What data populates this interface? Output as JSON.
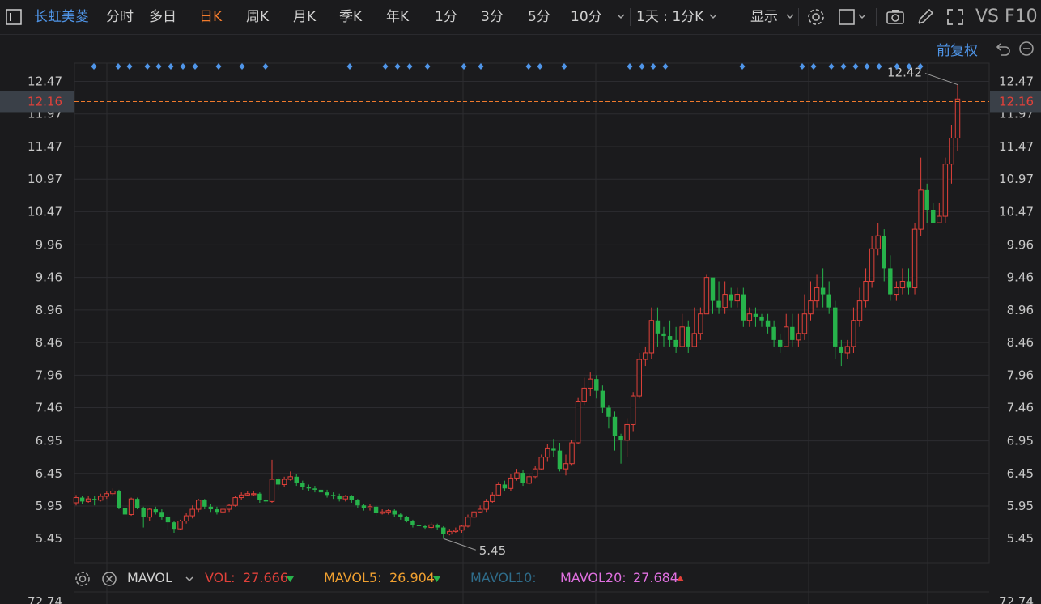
{
  "toolbar": {
    "stock_name": "长虹美菱",
    "periods": [
      "分时",
      "多日",
      "日K",
      "周K",
      "月K",
      "季K",
      "年K",
      "1分",
      "3分",
      "5分",
      "10分"
    ],
    "active_period": "日K",
    "interval_select": "1天 : 1分K",
    "display_label": "显示",
    "right_text": "VS F10"
  },
  "adjust_label": "前复权",
  "colors": {
    "up": "#e0413a",
    "down": "#27b34b",
    "accent": "#f07a2c",
    "link": "#4f95e8",
    "mavol5": "#f0a030",
    "mavol10": "#2f6c8a",
    "mavol20": "#e070e0",
    "grid": "#2c2c30"
  },
  "chart_data": {
    "type": "candlestick",
    "y_axis_ticks": [
      "12.47",
      "11.97",
      "11.47",
      "10.97",
      "10.47",
      "9.96",
      "9.46",
      "8.96",
      "8.46",
      "7.96",
      "7.46",
      "6.95",
      "6.45",
      "5.95",
      "5.45"
    ],
    "ylim": [
      5.08,
      12.75
    ],
    "current_price": "12.16",
    "max_label": "12.42",
    "min_label": "5.45",
    "bottom_axis_label": "72.74",
    "candles": [
      [
        6.0,
        6.08,
        6.12,
        5.96
      ],
      [
        6.08,
        6.02,
        6.1,
        5.98
      ],
      [
        6.02,
        6.06,
        6.1,
        6.0
      ],
      [
        6.06,
        6.04,
        6.1,
        5.96
      ],
      [
        6.04,
        6.1,
        6.14,
        6.02
      ],
      [
        6.1,
        6.14,
        6.18,
        6.06
      ],
      [
        6.14,
        6.18,
        6.22,
        6.1
      ],
      [
        6.18,
        5.92,
        6.2,
        5.9
      ],
      [
        5.92,
        5.82,
        5.96,
        5.8
      ],
      [
        5.82,
        6.06,
        6.08,
        5.8
      ],
      [
        6.06,
        5.92,
        6.08,
        5.9
      ],
      [
        5.92,
        5.78,
        5.94,
        5.62
      ],
      [
        5.78,
        5.9,
        5.92,
        5.72
      ],
      [
        5.9,
        5.86,
        5.94,
        5.82
      ],
      [
        5.86,
        5.78,
        5.9,
        5.74
      ],
      [
        5.78,
        5.7,
        5.82,
        5.58
      ],
      [
        5.7,
        5.6,
        5.72,
        5.54
      ],
      [
        5.6,
        5.72,
        5.74,
        5.58
      ],
      [
        5.72,
        5.8,
        5.84,
        5.68
      ],
      [
        5.8,
        5.9,
        5.96,
        5.76
      ],
      [
        5.9,
        6.04,
        6.06,
        5.86
      ],
      [
        6.04,
        5.94,
        6.06,
        5.9
      ],
      [
        5.94,
        5.9,
        5.98,
        5.86
      ],
      [
        5.9,
        5.86,
        5.94,
        5.82
      ],
      [
        5.86,
        5.9,
        5.92,
        5.82
      ],
      [
        5.9,
        5.96,
        5.98,
        5.86
      ],
      [
        5.96,
        6.08,
        6.1,
        5.94
      ],
      [
        6.08,
        6.12,
        6.16,
        6.04
      ],
      [
        6.12,
        6.14,
        6.18,
        6.1
      ],
      [
        6.14,
        6.14,
        6.18,
        6.1
      ],
      [
        6.14,
        6.04,
        6.16,
        6.0
      ],
      [
        6.04,
        6.02,
        6.06,
        5.98
      ],
      [
        6.02,
        6.36,
        6.66,
        6.0
      ],
      [
        6.36,
        6.28,
        6.4,
        6.2
      ],
      [
        6.28,
        6.36,
        6.4,
        6.24
      ],
      [
        6.36,
        6.4,
        6.48,
        6.34
      ],
      [
        6.4,
        6.3,
        6.44,
        6.26
      ],
      [
        6.3,
        6.24,
        6.34,
        6.2
      ],
      [
        6.24,
        6.22,
        6.28,
        6.18
      ],
      [
        6.22,
        6.2,
        6.26,
        6.16
      ],
      [
        6.2,
        6.16,
        6.24,
        6.12
      ],
      [
        6.16,
        6.12,
        6.2,
        6.08
      ],
      [
        6.12,
        6.1,
        6.16,
        6.06
      ],
      [
        6.1,
        6.06,
        6.14,
        6.02
      ],
      [
        6.06,
        6.1,
        6.12,
        6.02
      ],
      [
        6.1,
        6.04,
        6.12,
        6.0
      ],
      [
        6.04,
        5.96,
        6.06,
        5.92
      ],
      [
        5.96,
        5.92,
        5.98,
        5.88
      ],
      [
        5.92,
        5.94,
        5.98,
        5.88
      ],
      [
        5.94,
        5.84,
        5.96,
        5.8
      ],
      [
        5.84,
        5.86,
        5.9,
        5.82
      ],
      [
        5.86,
        5.88,
        5.9,
        5.82
      ],
      [
        5.88,
        5.82,
        5.9,
        5.78
      ],
      [
        5.82,
        5.78,
        5.84,
        5.74
      ],
      [
        5.78,
        5.72,
        5.8,
        5.7
      ],
      [
        5.72,
        5.66,
        5.74,
        5.62
      ],
      [
        5.66,
        5.64,
        5.68,
        5.6
      ],
      [
        5.64,
        5.62,
        5.66,
        5.6
      ],
      [
        5.62,
        5.66,
        5.7,
        5.6
      ],
      [
        5.66,
        5.62,
        5.68,
        5.58
      ],
      [
        5.62,
        5.52,
        5.64,
        5.45
      ],
      [
        5.52,
        5.56,
        5.6,
        5.5
      ],
      [
        5.56,
        5.58,
        5.62,
        5.54
      ],
      [
        5.58,
        5.64,
        5.66,
        5.54
      ],
      [
        5.64,
        5.78,
        5.82,
        5.62
      ],
      [
        5.78,
        5.86,
        5.88,
        5.76
      ],
      [
        5.86,
        5.9,
        5.96,
        5.84
      ],
      [
        5.9,
        6.02,
        6.06,
        5.86
      ],
      [
        6.02,
        6.12,
        6.16,
        6.0
      ],
      [
        6.12,
        6.28,
        6.32,
        6.1
      ],
      [
        6.28,
        6.22,
        6.34,
        6.18
      ],
      [
        6.22,
        6.38,
        6.44,
        6.18
      ],
      [
        6.38,
        6.46,
        6.52,
        6.34
      ],
      [
        6.46,
        6.3,
        6.5,
        6.26
      ],
      [
        6.3,
        6.4,
        6.44,
        6.28
      ],
      [
        6.4,
        6.52,
        6.56,
        6.38
      ],
      [
        6.52,
        6.7,
        6.74,
        6.5
      ],
      [
        6.7,
        6.84,
        6.9,
        6.64
      ],
      [
        6.84,
        6.8,
        6.98,
        6.7
      ],
      [
        6.8,
        6.52,
        6.92,
        6.48
      ],
      [
        6.52,
        6.6,
        6.74,
        6.42
      ],
      [
        6.6,
        6.92,
        6.96,
        6.58
      ],
      [
        6.92,
        7.56,
        7.62,
        6.9
      ],
      [
        7.56,
        7.76,
        7.92,
        7.5
      ],
      [
        7.76,
        7.9,
        8.0,
        7.64
      ],
      [
        7.9,
        7.72,
        7.96,
        7.6
      ],
      [
        7.72,
        7.46,
        7.8,
        7.38
      ],
      [
        7.46,
        7.32,
        7.5,
        7.14
      ],
      [
        7.32,
        7.02,
        7.4,
        6.8
      ],
      [
        7.02,
        6.96,
        7.06,
        6.6
      ],
      [
        6.96,
        7.2,
        7.3,
        6.7
      ],
      [
        7.2,
        7.64,
        7.7,
        7.1
      ],
      [
        7.64,
        8.2,
        8.3,
        7.6
      ],
      [
        8.2,
        8.3,
        8.4,
        8.1
      ],
      [
        8.3,
        8.8,
        9.0,
        8.2
      ],
      [
        8.8,
        8.6,
        9.0,
        8.4
      ],
      [
        8.6,
        8.56,
        8.7,
        8.4
      ],
      [
        8.56,
        8.5,
        8.8,
        8.4
      ],
      [
        8.5,
        8.4,
        8.7,
        8.3
      ],
      [
        8.4,
        8.7,
        8.9,
        8.5
      ],
      [
        8.7,
        8.4,
        8.8,
        8.3
      ],
      [
        8.4,
        8.6,
        9.0,
        8.4
      ],
      [
        8.6,
        8.9,
        9.0,
        8.5
      ],
      [
        8.9,
        9.46,
        9.5,
        8.9
      ],
      [
        9.46,
        9.1,
        9.4,
        8.9
      ],
      [
        9.1,
        9.0,
        9.4,
        8.9
      ],
      [
        9.0,
        9.2,
        9.4,
        8.9
      ],
      [
        9.2,
        9.1,
        9.3,
        9.0
      ],
      [
        9.1,
        9.2,
        9.3,
        9.0
      ],
      [
        9.2,
        8.8,
        9.3,
        8.7
      ],
      [
        8.8,
        8.9,
        9.0,
        8.7
      ],
      [
        8.9,
        8.86,
        9.0,
        8.7
      ],
      [
        8.86,
        8.8,
        8.9,
        8.7
      ],
      [
        8.8,
        8.7,
        8.9,
        8.6
      ],
      [
        8.7,
        8.5,
        8.8,
        8.4
      ],
      [
        8.5,
        8.4,
        8.6,
        8.3
      ],
      [
        8.4,
        8.7,
        8.9,
        8.4
      ],
      [
        8.7,
        8.5,
        8.9,
        8.4
      ],
      [
        8.5,
        8.6,
        8.9,
        8.4
      ],
      [
        8.6,
        8.9,
        9.2,
        8.5
      ],
      [
        8.9,
        9.1,
        9.4,
        8.8
      ],
      [
        9.1,
        9.3,
        9.5,
        9.0
      ],
      [
        9.3,
        9.2,
        9.6,
        9.0
      ],
      [
        9.2,
        9.0,
        9.4,
        8.9
      ],
      [
        9.0,
        8.4,
        9.1,
        8.2
      ],
      [
        8.4,
        8.3,
        8.5,
        8.1
      ],
      [
        8.3,
        8.4,
        8.5,
        8.2
      ],
      [
        8.4,
        8.8,
        9.0,
        8.3
      ],
      [
        8.8,
        9.1,
        9.3,
        8.7
      ],
      [
        9.1,
        9.4,
        9.6,
        9.0
      ],
      [
        9.4,
        9.9,
        10.1,
        9.3
      ],
      [
        9.9,
        10.1,
        10.3,
        9.8
      ],
      [
        10.1,
        9.6,
        10.2,
        9.4
      ],
      [
        9.6,
        9.2,
        9.8,
        9.1
      ],
      [
        9.2,
        9.3,
        9.4,
        9.1
      ],
      [
        9.3,
        9.4,
        9.6,
        9.2
      ],
      [
        9.4,
        9.3,
        9.6,
        9.2
      ],
      [
        9.3,
        10.2,
        10.3,
        9.2
      ],
      [
        10.2,
        10.8,
        11.3,
        10.1
      ],
      [
        10.8,
        10.5,
        10.9,
        10.3
      ],
      [
        10.5,
        10.3,
        10.6,
        10.3
      ],
      [
        10.3,
        10.4,
        10.6,
        10.3
      ],
      [
        10.4,
        11.2,
        11.3,
        10.3
      ],
      [
        11.2,
        11.6,
        11.8,
        10.9
      ],
      [
        11.6,
        12.2,
        12.42,
        11.4
      ]
    ]
  },
  "volume_bar": {
    "mavol_label": "MAVOL",
    "vol_label": "VOL:",
    "vol_value": "27.666",
    "mavol5_label": "MAVOL5:",
    "mavol5_value": "26.904",
    "mavol10_label": "MAVOL10:",
    "mavol20_label": "MAVOL20:",
    "mavol20_value": "27.684"
  }
}
